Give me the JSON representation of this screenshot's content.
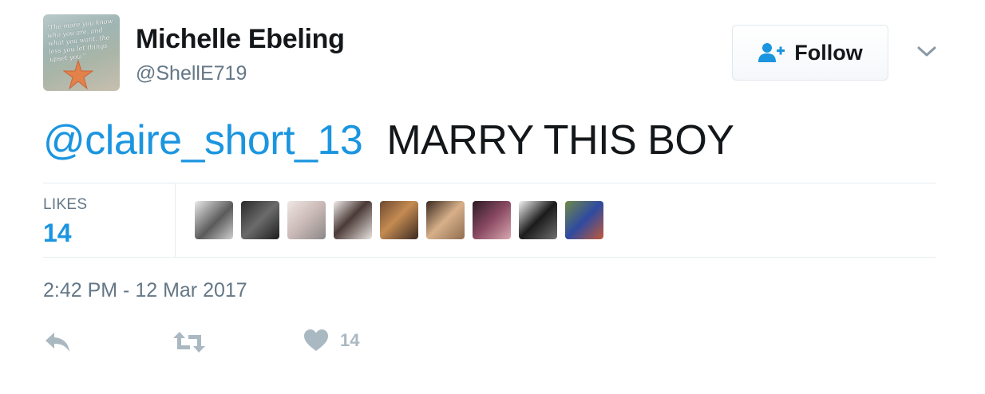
{
  "user": {
    "name": "Michelle Ebeling",
    "handle": "@ShellE719",
    "avatar_quote": "\"The more you know who you are, and what you want, the less you let things upset you.\""
  },
  "follow": {
    "label": "Follow"
  },
  "tweet": {
    "mention": "@claire_short_13",
    "text": "MARRY THIS BOY"
  },
  "stats": {
    "likes_label": "LIKES",
    "likes_count": "14"
  },
  "timestamp": "2:42 PM - 12 Mar 2017",
  "actions": {
    "like_count": "14"
  },
  "likers": [
    {
      "bg": "linear-gradient(135deg,#e9e9e9,#5a5a5a 55%,#cfcfcf)"
    },
    {
      "bg": "linear-gradient(135deg,#2a2a2a,#6b6b6b 50%,#1d1d1d)"
    },
    {
      "bg": "linear-gradient(135deg,#efe6e4,#c9b9b6 50%,#8b8888)"
    },
    {
      "bg": "linear-gradient(135deg,#f2eeec,#4a3a36 45%,#e9e4e2)"
    },
    {
      "bg": "linear-gradient(135deg,#6d4a30,#c58b52 45%,#3a2a20)"
    },
    {
      "bg": "linear-gradient(135deg,#3a2a20,#d7b08a 50%,#8f6d4f)"
    },
    {
      "bg": "linear-gradient(135deg,#2d1b25,#8a4a62 50%,#d8a7b0)"
    },
    {
      "bg": "linear-gradient(135deg,#f4f4f4,#1b1b1b 50%,#707070)"
    },
    {
      "bg": "linear-gradient(135deg,#6f8a4a,#2f4aa0 50%,#c05a3a)"
    }
  ],
  "colors": {
    "link": "#1b95e0",
    "muted": "#657786",
    "action_icon": "#aab8c2"
  },
  "icons": {
    "follow": "person-add-icon",
    "more": "chevron-down-icon",
    "reply": "reply-icon",
    "retweet": "retweet-icon",
    "like": "heart-icon"
  }
}
